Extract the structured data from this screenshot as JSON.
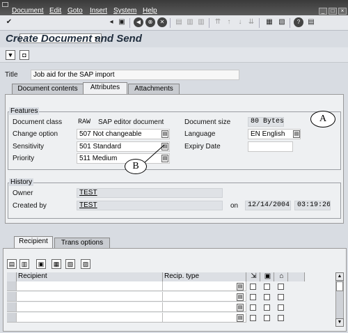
{
  "menu": {
    "items": [
      "Document",
      "Edit",
      "Goto",
      "Insert",
      "System",
      "Help"
    ]
  },
  "screen": {
    "title": "Create Document and Send"
  },
  "doc": {
    "title_label": "Title",
    "title_value": "Job aid for the SAP import"
  },
  "tabs": [
    "Document contents",
    "Attributes",
    "Attachments"
  ],
  "features": {
    "group_title": "Features",
    "doc_class_label": "Document class",
    "doc_class_code": "RAW",
    "doc_class_text": "SAP editor document",
    "change_label": "Change option",
    "change_value": "507 Not changeable",
    "sensitivity_label": "Sensitivity",
    "sensitivity_value": "501 Standard",
    "priority_label": "Priority",
    "priority_value": "511 Medium",
    "size_label": "Document size",
    "size_value": "80 Bytes",
    "language_label": "Language",
    "language_value": "EN English",
    "expiry_label": "Expiry Date",
    "expiry_value": ""
  },
  "history": {
    "group_title": "History",
    "owner_label": "Owner",
    "owner_value": "TEST",
    "created_label": "Created by",
    "created_value": "TEST",
    "on_label": "on",
    "date_value": "12/14/2004",
    "time_value": "03:19:26"
  },
  "lower_tabs": [
    "Recipient",
    "Trans options"
  ],
  "table": {
    "col_recipient": "Recipient",
    "col_type": "Recip. type"
  },
  "callouts": {
    "a": "A",
    "b": "B"
  }
}
